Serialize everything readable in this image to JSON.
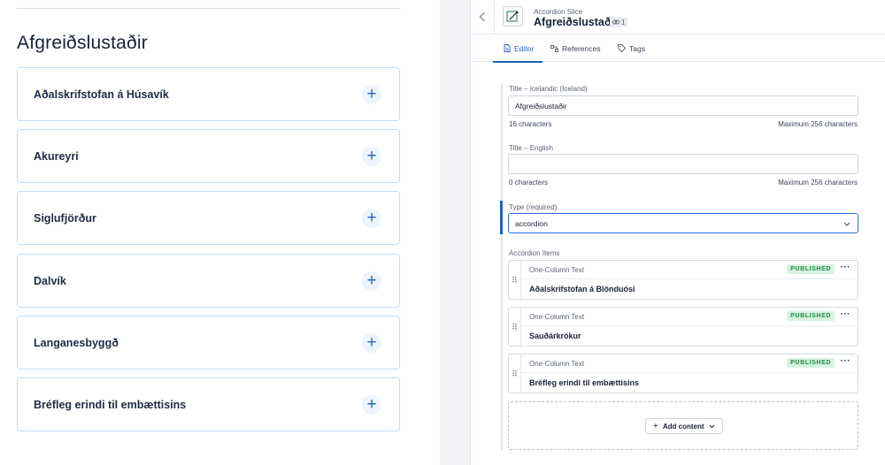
{
  "preview": {
    "title": "Afgreiðslustaðir",
    "items": [
      {
        "label": "Aðalskrifstofan á Húsavík"
      },
      {
        "label": "Akureyri"
      },
      {
        "label": "Siglufjörður"
      },
      {
        "label": "Dalvík"
      },
      {
        "label": "Langanesbyggð"
      },
      {
        "label": "Bréfleg erindi til embættisins"
      }
    ],
    "plus_symbol": "+"
  },
  "editor": {
    "header": {
      "back_icon": "chevron-left-icon",
      "slice_type": "Accordion Slice",
      "slice_name": "Afgreiðslustaðir",
      "link_count": "1"
    },
    "tabs": [
      {
        "label": "Editor",
        "icon": "document-icon",
        "active": true
      },
      {
        "label": "References",
        "icon": "references-icon",
        "active": false
      },
      {
        "label": "Tags",
        "icon": "tag-icon",
        "active": false
      }
    ],
    "fields": {
      "title_is": {
        "label": "Title – Icelandic (Iceland)",
        "value": "Afgreiðslustaðir",
        "count": "16 characters",
        "max": "Maximum 256 characters"
      },
      "title_en": {
        "label": "Title – English",
        "value": "",
        "count": "0 characters",
        "max": "Maximum 256 characters"
      },
      "type": {
        "label": "Type (required)",
        "value": "accordion"
      }
    },
    "accordion_items": {
      "label": "Accordion Items",
      "items": [
        {
          "type": "One-Column Text",
          "status": "PUBLISHED",
          "title": "Aðalskrifstofan á Blönduósi"
        },
        {
          "type": "One-Column Text",
          "status": "PUBLISHED",
          "title": "Sauðárkrókur"
        },
        {
          "type": "One-Column Text",
          "status": "PUBLISHED",
          "title": "Bréfleg erindi til embættisins"
        }
      ],
      "add_label": "Add content"
    },
    "colors": {
      "accent": "#1f5fbf",
      "published_bg": "#d6f3df",
      "published_text": "#1f8a45"
    }
  }
}
